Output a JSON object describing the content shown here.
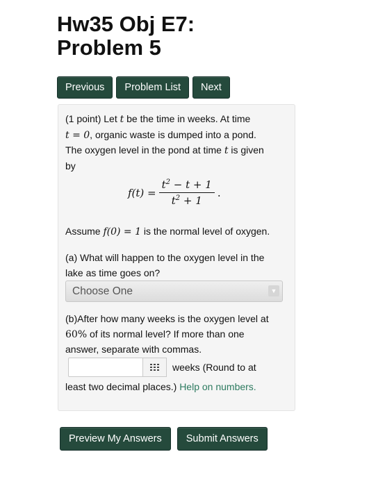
{
  "header": {
    "title_line1": "Hw35 Obj E7:",
    "title_line2": "Problem 5"
  },
  "nav": {
    "previous": "Previous",
    "problem_list": "Problem List",
    "next": "Next"
  },
  "problem": {
    "intro_prefix": "(1 point) Let ",
    "var_t": "t",
    "intro_mid": " be the time in weeks. At time",
    "t_eq_0": "t = 0",
    "intro_rest": ", organic waste is dumped into a pond.",
    "line3": "The oxygen level in the pond at time ",
    "line3_end": " is given",
    "line4": "by",
    "formula": {
      "lhs": "f(t) =",
      "num_pre": "t",
      "num_post": " − t + 1",
      "den_pre": "t",
      "den_post": " + 1",
      "exp": "2",
      "end": "."
    },
    "assume_prefix": "Assume ",
    "assume_math": "f(0) = 1",
    "assume_suffix": " is the normal level of oxygen.",
    "part_a_line1": "(a) What will happen to the oxygen level in the",
    "part_a_line2": "lake as time goes on?",
    "select_value": "Choose One",
    "part_b_line1": "(b)After how many weeks is the oxygen level at",
    "part_b_pct": "60%",
    "part_b_line2_rest": " of its normal level? If more than one",
    "part_b_line3": "answer, separate with commas.",
    "answer_value": "",
    "after_input": "weeks (Round to at",
    "least_line": "least two decimal places.) ",
    "help_link": "Help on numbers."
  },
  "actions": {
    "preview": "Preview My Answers",
    "submit": "Submit Answers"
  },
  "colors": {
    "button": "#254a3c",
    "link": "#2c7a5f",
    "panel": "#f5f5f5"
  },
  "icons": {
    "keypad": "keypad-icon",
    "dropdown": "chevron-down-icon"
  }
}
